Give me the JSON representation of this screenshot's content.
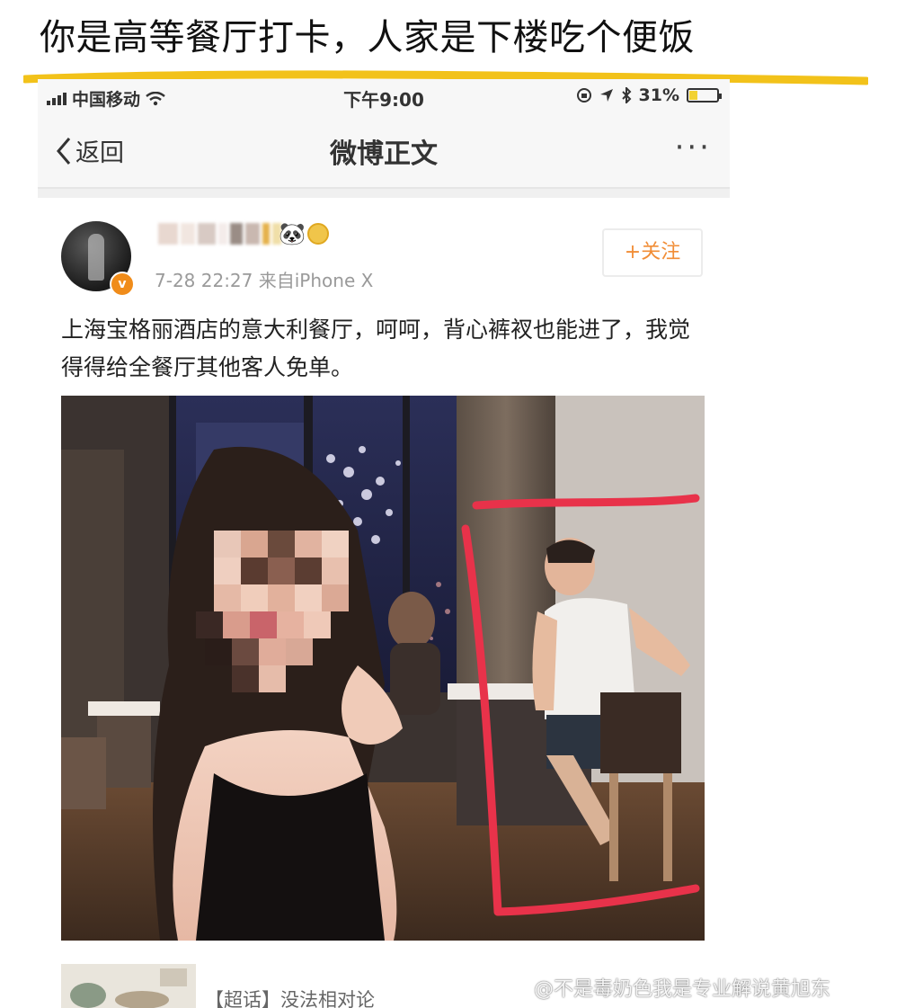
{
  "headline": "你是高等餐厅打卡，人家是下楼吃个便饭",
  "colors": {
    "highlight": "#f2c21a",
    "follow_orange": "#f18d36",
    "annotation_red": "#e8324a"
  },
  "status_bar": {
    "carrier": "中国移动",
    "time": "下午9:00",
    "battery": "31%",
    "battery_level": 0.31,
    "icons": [
      "signal-icon",
      "wifi-icon",
      "lock-rotation-icon",
      "location-icon",
      "bluetooth-icon",
      "battery-icon"
    ]
  },
  "nav": {
    "back_label": "返回",
    "title": "微博正文",
    "more": "···"
  },
  "post": {
    "meta": "7-28 22:27  来自iPhone X",
    "follow_label": "+关注",
    "verified_badge": "v",
    "text": "上海宝格丽酒店的意大利餐厅，呵呵，背心裤衩也能进了，我觉得得给全餐厅其他客人免单。"
  },
  "footer": {
    "topic": "【超话】没法相对论"
  },
  "watermark": {
    "text": "@不是毒奶色我是专业解说黄旭东"
  }
}
